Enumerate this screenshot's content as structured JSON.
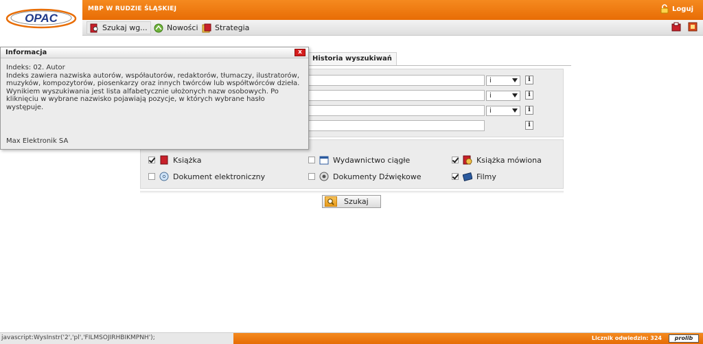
{
  "header": {
    "logo_text": "OPAC",
    "site_title": "MBP W RUDZIE ŚLĄSKIEJ",
    "login_label": "Loguj"
  },
  "nav": {
    "items": [
      {
        "label": "Szukaj wg..."
      },
      {
        "label": "Nowości"
      },
      {
        "label": "Strategia"
      }
    ]
  },
  "tabs": {
    "history_label": "Historia wyszukiwań"
  },
  "search_form": {
    "rows": [
      {
        "value": "",
        "select": "i"
      },
      {
        "value": "",
        "select": "i"
      },
      {
        "value": "",
        "select": "i"
      },
      {
        "value": ""
      }
    ],
    "info_label": "i"
  },
  "types": [
    {
      "label": "Książka",
      "checked": true
    },
    {
      "label": "Wydawnictwo ciągłe",
      "checked": false
    },
    {
      "label": "Książka mówiona",
      "checked": true
    },
    {
      "label": "Dokument elektroniczny",
      "checked": false
    },
    {
      "label": "Dokumenty Dźwiękowe",
      "checked": false
    },
    {
      "label": "Filmy",
      "checked": true
    }
  ],
  "search_button": "Szukaj",
  "popup": {
    "title": "Informacja",
    "close_label": "x",
    "heading": "Indeks: 02. Autor",
    "text": "Indeks zawiera nazwiska autorów, współautorów, redaktorów, tłumaczy, ilustratorów, muzyków, kompozytorów, piosenkarzy oraz innych twórców lub współtwórców dzieła. Wynikiem wyszukiwania jest lista alfabetycznie ułożonych nazw osobowych. Po kliknięciu w wybrane nazwisko pojawiają pozycje, w których wybrane hasło występuje.",
    "footer": "Max Elektronik SA"
  },
  "statusbar": {
    "url": "javascript:WysInstr('2','pl','FILMSOJIRHBIKMPNH');",
    "counter": "Licznik odwiedzin: 324",
    "brand": "prolib"
  },
  "colors": {
    "accent_orange": "#e86d05",
    "close_red": "#d51c1c"
  }
}
